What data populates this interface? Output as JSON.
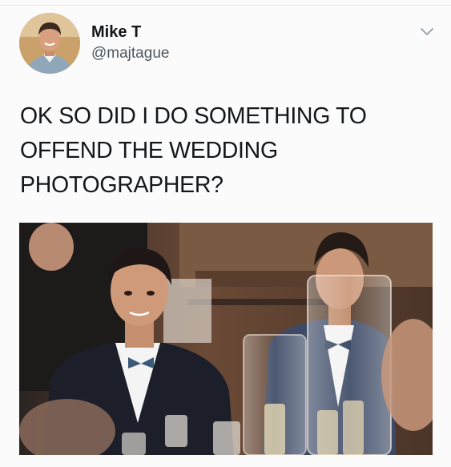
{
  "tweet": {
    "author": {
      "display_name": "Mike T",
      "handle": "@majtague",
      "avatar_icon": "profile-photo"
    },
    "menu_icon": "chevron-down-icon",
    "text": "OK SO DID I DO SOMETHING TO\nOFFEND THE WEDDING\nPHOTOGRAPHER?",
    "media": {
      "type": "photo",
      "icon": "wedding-photo"
    }
  },
  "colors": {
    "text": "#14171a",
    "handle": "#4b5660",
    "chevron": "#8899a6",
    "divider": "#e6ecf0"
  }
}
